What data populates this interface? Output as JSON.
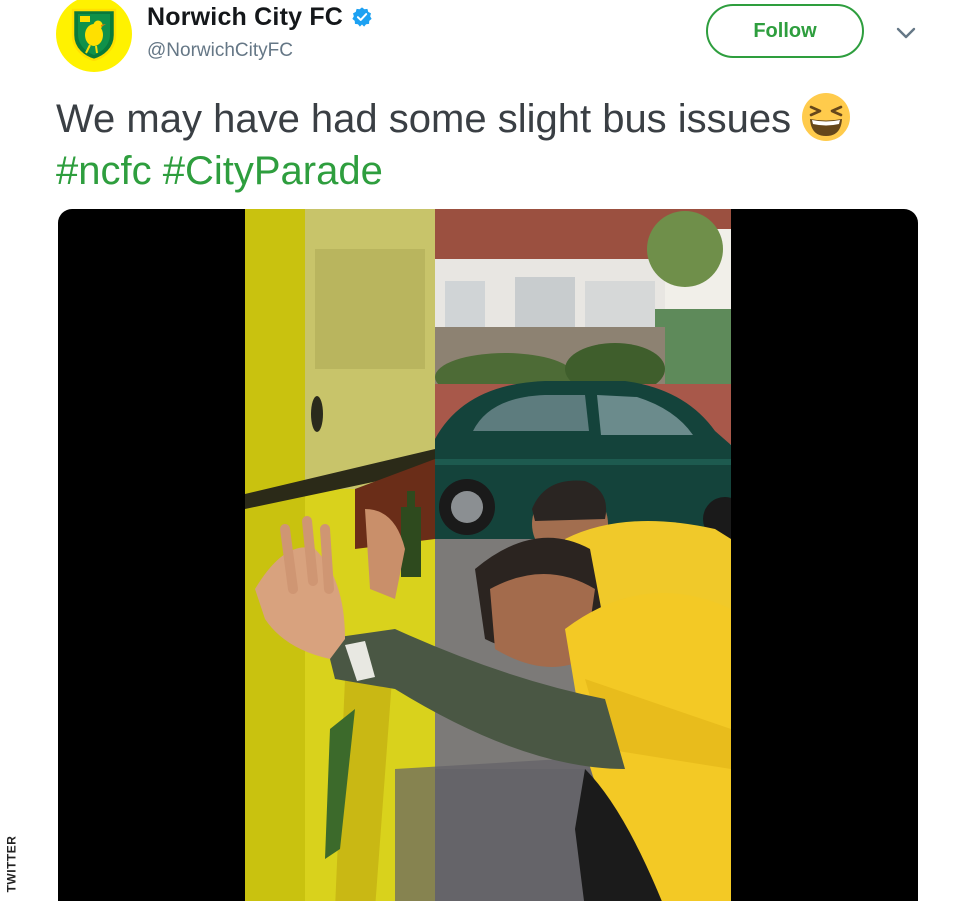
{
  "account": {
    "display_name": "Norwich City FC",
    "handle": "@NorwichCityFC",
    "verified": true,
    "avatar_icon": "norwich-crest-icon"
  },
  "actions": {
    "follow_label": "Follow",
    "menu_icon": "chevron-down-icon"
  },
  "tweet": {
    "text": "We may have had some slight bus issues",
    "emoji": "grinning-squinting-face-icon",
    "hashtags": [
      "#ncfc",
      "#CityParade"
    ]
  },
  "media": {
    "type": "video",
    "description_icon": "video-thumbnail"
  },
  "credit": {
    "label": "TWITTER"
  },
  "colors": {
    "accent": "#2e9e3e",
    "verified_blue": "#1da1f2",
    "text": "#3a3f44",
    "muted": "#657786",
    "avatar_bg": "#fff200"
  }
}
